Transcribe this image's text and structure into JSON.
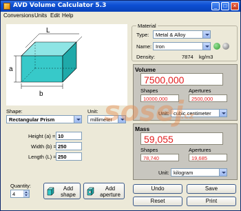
{
  "window": {
    "title": "AVD Volume Calculator 5.3"
  },
  "titlebar_buttons": {
    "minimize": "_",
    "maximize": "□",
    "close": "×"
  },
  "menu": {
    "items": [
      "Conversions",
      "Units",
      "Edit",
      "Help"
    ]
  },
  "diagram": {
    "dim_l": "L",
    "dim_a": "a",
    "dim_b": "b"
  },
  "shape": {
    "label": "Shape:",
    "value": "Rectangular Prism"
  },
  "unit_left": {
    "label": "Unit:",
    "value": "millimeter"
  },
  "dimensions": [
    {
      "label": "Height (a) =",
      "value": "10"
    },
    {
      "label": "Width (b) =",
      "value": "250"
    },
    {
      "label": "Length (L) =",
      "value": "250"
    }
  ],
  "quantity": {
    "label": "Quantity:",
    "value": "4"
  },
  "buttons": {
    "add_shape": "Add shape",
    "add_aperture": "Add aperture"
  },
  "material": {
    "group_title": "Material",
    "type_label": "Type:",
    "type_value": "Metal & Alloy",
    "name_label": "Name:",
    "name_value": "Iron",
    "density_label": "Density:",
    "density_value": "7874",
    "density_unit": "kg/m3"
  },
  "volume": {
    "title": "Volume",
    "total": "7500,000",
    "shapes_label": "Shapes",
    "shapes_value": "10000,000",
    "apertures_label": "Apertures",
    "apertures_value": "2500,000",
    "unit_label": "Unit:",
    "unit_value": "cubic centimeter"
  },
  "mass": {
    "title": "Mass",
    "total": "59,055",
    "shapes_label": "Shapes",
    "shapes_value": "78,740",
    "apertures_label": "Apertures",
    "apertures_value": "19,685",
    "unit_label": "Unit:",
    "unit_value": "kilogram"
  },
  "actions": {
    "undo": "Undo",
    "save": "Save",
    "reset": "Reset",
    "print": "Print"
  },
  "watermark": {
    "text": "sosej",
    "suffix": ".cz"
  },
  "colors": {
    "title_blue": "#0d4fd3",
    "result_red": "#e21c1c",
    "box_cyan": "#37c9c9",
    "go_green": "#2e9a2e"
  }
}
